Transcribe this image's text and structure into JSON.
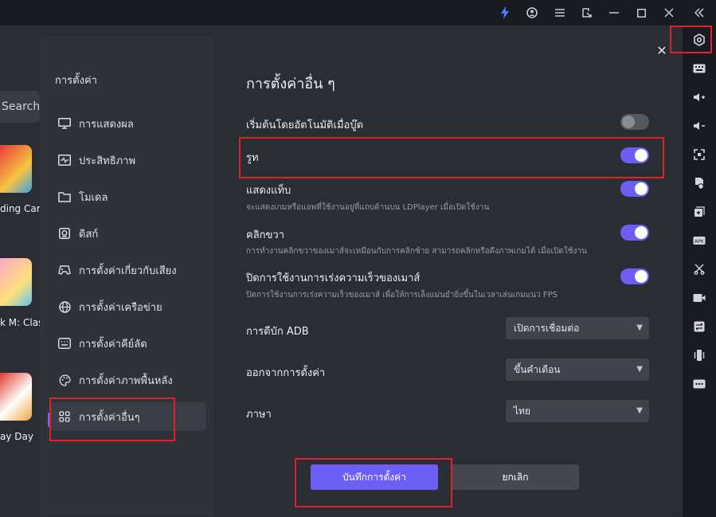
{
  "topbar": {
    "icons": [
      "bolt-icon",
      "user-icon",
      "menu-icon",
      "popout-icon",
      "minimize-icon",
      "maximize-icon",
      "close-icon",
      "collapse-icon"
    ],
    "accent": "#4d7cff"
  },
  "background_app": {
    "search_text": "Search",
    "games": [
      "ding Card",
      "k M: Clas",
      "ay Day"
    ]
  },
  "settings": {
    "sidebar_title": "การตั้งค่า",
    "nav": [
      {
        "label": "การแสดงผล",
        "icon": "monitor-icon"
      },
      {
        "label": "ประสิทธิภาพ",
        "icon": "performance-icon"
      },
      {
        "label": "โมเดล",
        "icon": "folder-icon"
      },
      {
        "label": "ดิสก์",
        "icon": "disk-icon"
      },
      {
        "label": "การตั้งค่าเกี่ยวกับเสียง",
        "icon": "gamepad-icon"
      },
      {
        "label": "การตั้งค่าเครือข่าย",
        "icon": "globe-icon"
      },
      {
        "label": "การตั้งค่าคีย์ลัด",
        "icon": "keyboard-icon"
      },
      {
        "label": "การตั้งค่าภาพพื้นหลัง",
        "icon": "palette-icon"
      },
      {
        "label": "การตั้งค่าอื่นๆ",
        "icon": "grid-icon"
      }
    ],
    "active_index": 8,
    "section_title": "การตั้งค่าอื่น ๆ",
    "rows": {
      "autostart": {
        "title": "เริ่มต้นโดยอัตโนมัติเมื่อบู๊ต",
        "on": false
      },
      "root": {
        "title": "รูท",
        "on": true
      },
      "show_tab": {
        "title": "แสดงแท็บ",
        "desc": "จะแสดงเกมหรือแอพที่ใช้งานอยู่ที่แถบด้านบน LDPlayer เมื่อเปิดใช้งาน",
        "on": true
      },
      "right_click": {
        "title": "คลิกขวา",
        "desc": "การทำงานคลิกขวาของเมาส์จะเหมือนกับการคลิกซ้าย สามารถคลิกหรือดึงภาพเกมได้ เมื่อเปิดใช้งาน",
        "on": true
      },
      "mouse_accel": {
        "title": "ปิดการใช้งานการเร่งความเร็วของเมาส์",
        "desc": "ปิดการใช้งานการเร่งความเร็วของเมาส์ เพื่อให้การเล็งแม่นยำยิ่งขึ้นในเวลาเล่นเกมแนว FPS",
        "on": true
      }
    },
    "selects": {
      "adb": {
        "label": "การดีบัก ADB",
        "value": "เปิดการเชื่อมต่อ"
      },
      "exit": {
        "label": "ออกจากการตั้งค่า",
        "value": "ขึ้นคำเตือน"
      },
      "language": {
        "label": "ภาษา",
        "value": "ไทย"
      }
    },
    "save_label": "บันทึกการตั้งค่า",
    "cancel_label": "ยกเลิก",
    "accent": "#6d5ef7"
  }
}
